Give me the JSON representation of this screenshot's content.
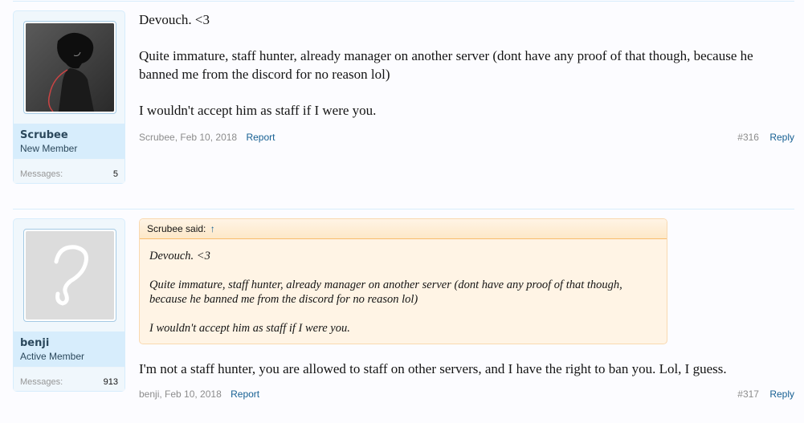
{
  "posts": [
    {
      "author": "Scrubee",
      "user_title": "New Member",
      "messages_label": "Messages:",
      "messages_count": "5",
      "avatar": "anime-character-avatar",
      "paragraphs": [
        "Devouch. <3",
        "Quite immature, staff hunter, already manager on another server (dont have any proof of that though, because he banned me from the discord for no reason lol)",
        "I wouldn't accept him as staff if I were you."
      ],
      "meta_author": "Scrubee",
      "date": "Feb 10, 2018",
      "report_label": "Report",
      "post_number": "#316",
      "reply_label": "Reply"
    },
    {
      "author": "benji",
      "user_title": "Active Member",
      "messages_label": "Messages:",
      "messages_count": "913",
      "avatar": "default-question-mark-avatar",
      "quote": {
        "header": "Scrubee said:",
        "arrow": "↑",
        "paragraphs": [
          "Devouch. <3",
          "Quite immature, staff hunter, already manager on another server (dont have any proof of that though, because he banned me from the discord for no reason lol)",
          "I wouldn't accept him as staff if I were you."
        ]
      },
      "paragraphs": [
        "I'm not a staff hunter, you are allowed to staff on other servers, and I have the right to ban you. Lol, I guess."
      ],
      "meta_author": "benji",
      "date": "Feb 10, 2018",
      "report_label": "Report",
      "post_number": "#317",
      "reply_label": "Reply"
    }
  ],
  "colors": {
    "link": "#176093",
    "username": "#2b485c",
    "quote_bg": "#fff4e5",
    "quote_border": "#f9bc6d",
    "sidebar_bg": "#f0f7fc",
    "name_panel_bg": "#d7edfc"
  }
}
